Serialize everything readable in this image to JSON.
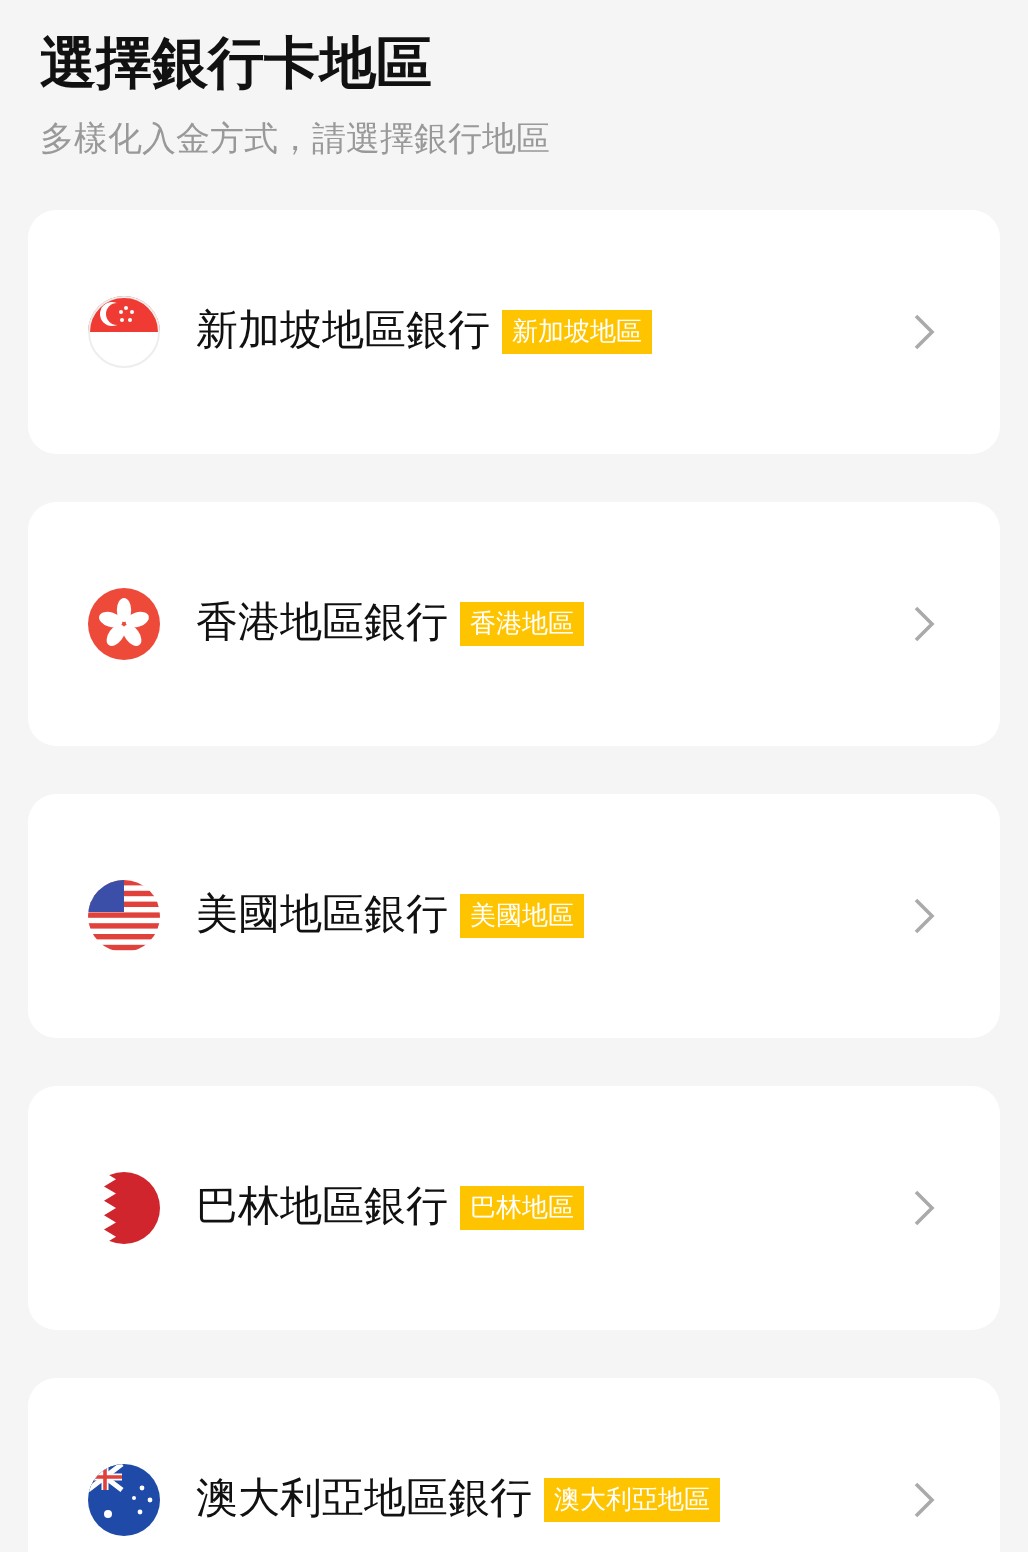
{
  "title": "選擇銀行卡地區",
  "subtitle": "多樣化入金方式，請選擇銀行地區",
  "regions": [
    {
      "kind": "sg",
      "name": "新加坡地區銀行",
      "badge": "新加坡地區"
    },
    {
      "kind": "hk",
      "name": "香港地區銀行",
      "badge": "香港地區"
    },
    {
      "kind": "us",
      "name": "美國地區銀行",
      "badge": "美國地區"
    },
    {
      "kind": "bh",
      "name": "巴林地區銀行",
      "badge": "巴林地區"
    },
    {
      "kind": "au",
      "name": "澳大利亞地區銀行",
      "badge": "澳大利亞地區"
    }
  ]
}
